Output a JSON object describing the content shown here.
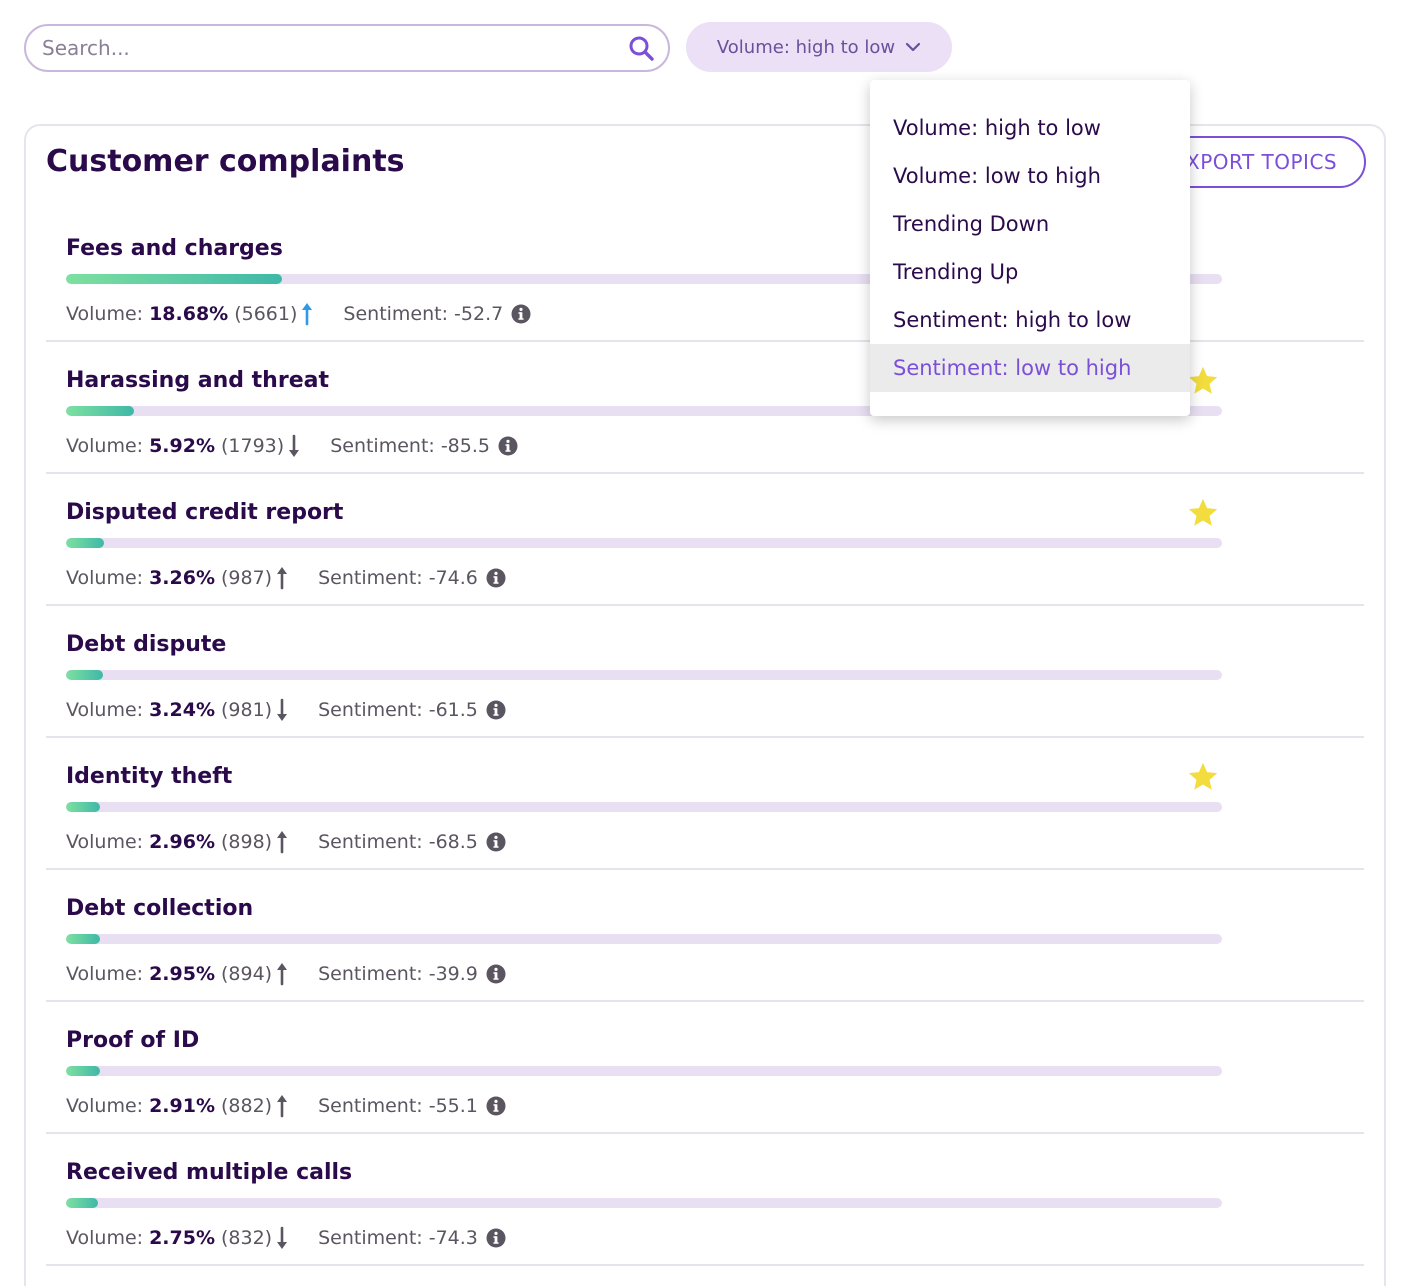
{
  "search": {
    "placeholder": "Search..."
  },
  "sort": {
    "selected": "Volume: high to low",
    "options": [
      "Volume: high to low",
      "Volume: low to high",
      "Trending Down",
      "Trending Up",
      "Sentiment: high to low",
      "Sentiment: low to high"
    ],
    "highlighted_index": 5
  },
  "panel": {
    "title": "Customer complaints",
    "export_label": "EXPORT TOPICS"
  },
  "labels": {
    "volume": "Volume:",
    "sentiment": "Sentiment:"
  },
  "colors": {
    "accent": "#7b4fd8",
    "title": "#2a0a4a",
    "trend_highlight": "#2f9ae8",
    "star": "#f2dc3e"
  },
  "topics": [
    {
      "name": "Fees and charges",
      "volume_pct": "18.68%",
      "volume_fraction": 0.1868,
      "count": "(5661)",
      "trend": "up",
      "trend_highlight": true,
      "sentiment": "-52.7",
      "starred": false
    },
    {
      "name": "Harassing and threat",
      "volume_pct": "5.92%",
      "volume_fraction": 0.0592,
      "count": "(1793)",
      "trend": "down",
      "trend_highlight": false,
      "sentiment": "-85.5",
      "starred": true
    },
    {
      "name": "Disputed credit report",
      "volume_pct": "3.26%",
      "volume_fraction": 0.0326,
      "count": "(987)",
      "trend": "up",
      "trend_highlight": false,
      "sentiment": "-74.6",
      "starred": true
    },
    {
      "name": "Debt dispute",
      "volume_pct": "3.24%",
      "volume_fraction": 0.0324,
      "count": "(981)",
      "trend": "down",
      "trend_highlight": false,
      "sentiment": "-61.5",
      "starred": false
    },
    {
      "name": "Identity theft",
      "volume_pct": "2.96%",
      "volume_fraction": 0.0296,
      "count": "(898)",
      "trend": "up",
      "trend_highlight": false,
      "sentiment": "-68.5",
      "starred": true
    },
    {
      "name": "Debt collection",
      "volume_pct": "2.95%",
      "volume_fraction": 0.0295,
      "count": "(894)",
      "trend": "up",
      "trend_highlight": false,
      "sentiment": "-39.9",
      "starred": false
    },
    {
      "name": "Proof of ID",
      "volume_pct": "2.91%",
      "volume_fraction": 0.0291,
      "count": "(882)",
      "trend": "up",
      "trend_highlight": false,
      "sentiment": "-55.1",
      "starred": false
    },
    {
      "name": "Received multiple calls",
      "volume_pct": "2.75%",
      "volume_fraction": 0.0275,
      "count": "(832)",
      "trend": "down",
      "trend_highlight": false,
      "sentiment": "-74.3",
      "starred": false
    }
  ]
}
